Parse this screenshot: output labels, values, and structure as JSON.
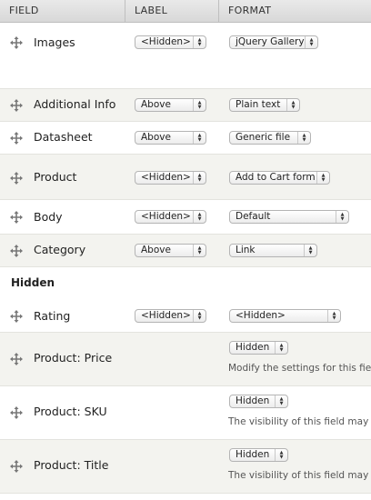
{
  "headers": {
    "field": "FIELD",
    "label": "LABEL",
    "format": "FORMAT"
  },
  "hidden_section_title": "Hidden",
  "rows": [
    {
      "field": "Images",
      "label": "<Hidden>",
      "format": "jQuery Gallery"
    },
    {
      "field": "Additional Info",
      "label": "Above",
      "format": "Plain text"
    },
    {
      "field": "Datasheet",
      "label": "Above",
      "format": "Generic file"
    },
    {
      "field": "Product",
      "label": "<Hidden>",
      "format": "Add to Cart form"
    },
    {
      "field": "Body",
      "label": "<Hidden>",
      "format": "Default"
    },
    {
      "field": "Category",
      "label": "Above",
      "format": "Link"
    },
    {
      "field": "Rating",
      "label": "<Hidden>",
      "format": "<Hidden>"
    },
    {
      "field": "Product: Price",
      "format": "Hidden",
      "description": "Modify the settings for this fie"
    },
    {
      "field": "Product: SKU",
      "format": "Hidden",
      "description": "The visibility of this field may"
    },
    {
      "field": "Product: Title",
      "format": "Hidden",
      "description": "The visibility of this field may"
    }
  ],
  "icons": {
    "drag": "drag-handle-icon",
    "select_arrow": "updown-arrow-icon"
  },
  "colors": {
    "header_bg": "#dcdcdc",
    "row_alt_bg": "#f3f3ef"
  }
}
